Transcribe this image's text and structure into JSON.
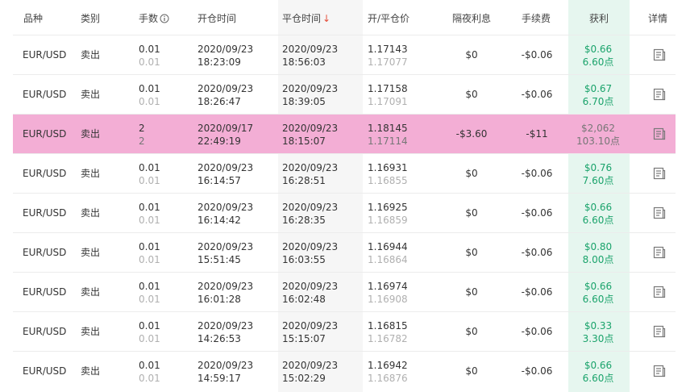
{
  "headers": {
    "symbol": "品种",
    "type": "类别",
    "lots": "手数",
    "open_time": "开仓时间",
    "close_time": "平仓时间",
    "price": "开/平仓价",
    "swap": "隔夜利息",
    "fee": "手续费",
    "profit": "获利",
    "detail": "详情",
    "sort_arrow": "↓"
  },
  "rows": [
    {
      "symbol": "EUR/USD",
      "type": "卖出",
      "lots": "0.01",
      "lots_close": "0.01",
      "open_date": "2020/09/23",
      "open_time": "18:23:09",
      "close_date": "2020/09/23",
      "close_time": "18:56:03",
      "open_price": "1.17143",
      "close_price": "1.17077",
      "swap": "$0",
      "fee": "-$0.06",
      "profit": "$0.66",
      "points": "6.60点"
    },
    {
      "symbol": "EUR/USD",
      "type": "卖出",
      "lots": "0.01",
      "lots_close": "0.01",
      "open_date": "2020/09/23",
      "open_time": "18:26:47",
      "close_date": "2020/09/23",
      "close_time": "18:39:05",
      "open_price": "1.17158",
      "close_price": "1.17091",
      "swap": "$0",
      "fee": "-$0.06",
      "profit": "$0.67",
      "points": "6.70点"
    },
    {
      "symbol": "EUR/USD",
      "type": "卖出",
      "lots": "2",
      "lots_close": "2",
      "open_date": "2020/09/17",
      "open_time": "22:49:19",
      "close_date": "2020/09/23",
      "close_time": "18:15:07",
      "open_price": "1.18145",
      "close_price": "1.17114",
      "swap": "-$3.60",
      "fee": "-$11",
      "profit": "$2,062",
      "points": "103.10点"
    },
    {
      "symbol": "EUR/USD",
      "type": "卖出",
      "lots": "0.01",
      "lots_close": "0.01",
      "open_date": "2020/09/23",
      "open_time": "16:14:57",
      "close_date": "2020/09/23",
      "close_time": "16:28:51",
      "open_price": "1.16931",
      "close_price": "1.16855",
      "swap": "$0",
      "fee": "-$0.06",
      "profit": "$0.76",
      "points": "7.60点"
    },
    {
      "symbol": "EUR/USD",
      "type": "卖出",
      "lots": "0.01",
      "lots_close": "0.01",
      "open_date": "2020/09/23",
      "open_time": "16:14:42",
      "close_date": "2020/09/23",
      "close_time": "16:28:35",
      "open_price": "1.16925",
      "close_price": "1.16859",
      "swap": "$0",
      "fee": "-$0.06",
      "profit": "$0.66",
      "points": "6.60点"
    },
    {
      "symbol": "EUR/USD",
      "type": "卖出",
      "lots": "0.01",
      "lots_close": "0.01",
      "open_date": "2020/09/23",
      "open_time": "15:51:45",
      "close_date": "2020/09/23",
      "close_time": "16:03:55",
      "open_price": "1.16944",
      "close_price": "1.16864",
      "swap": "$0",
      "fee": "-$0.06",
      "profit": "$0.80",
      "points": "8.00点"
    },
    {
      "symbol": "EUR/USD",
      "type": "卖出",
      "lots": "0.01",
      "lots_close": "0.01",
      "open_date": "2020/09/23",
      "open_time": "16:01:28",
      "close_date": "2020/09/23",
      "close_time": "16:02:48",
      "open_price": "1.16974",
      "close_price": "1.16908",
      "swap": "$0",
      "fee": "-$0.06",
      "profit": "$0.66",
      "points": "6.60点"
    },
    {
      "symbol": "EUR/USD",
      "type": "卖出",
      "lots": "0.01",
      "lots_close": "0.01",
      "open_date": "2020/09/23",
      "open_time": "14:26:53",
      "close_date": "2020/09/23",
      "close_time": "15:15:07",
      "open_price": "1.16815",
      "close_price": "1.16782",
      "swap": "$0",
      "fee": "-$0.06",
      "profit": "$0.33",
      "points": "3.30点"
    },
    {
      "symbol": "EUR/USD",
      "type": "卖出",
      "lots": "0.01",
      "lots_close": "0.01",
      "open_date": "2020/09/23",
      "open_time": "14:59:17",
      "close_date": "2020/09/23",
      "close_time": "15:02:29",
      "open_price": "1.16942",
      "close_price": "1.16876",
      "swap": "$0",
      "fee": "-$0.06",
      "profit": "$0.66",
      "points": "6.60点"
    }
  ],
  "highlighted_row": 2,
  "colors": {
    "profit": "#1aa36b",
    "highlight": "#f3aed5",
    "sort_arrow": "#e44d3a"
  },
  "icons": {
    "info": "info-circle-icon",
    "detail": "document-detail-icon"
  }
}
